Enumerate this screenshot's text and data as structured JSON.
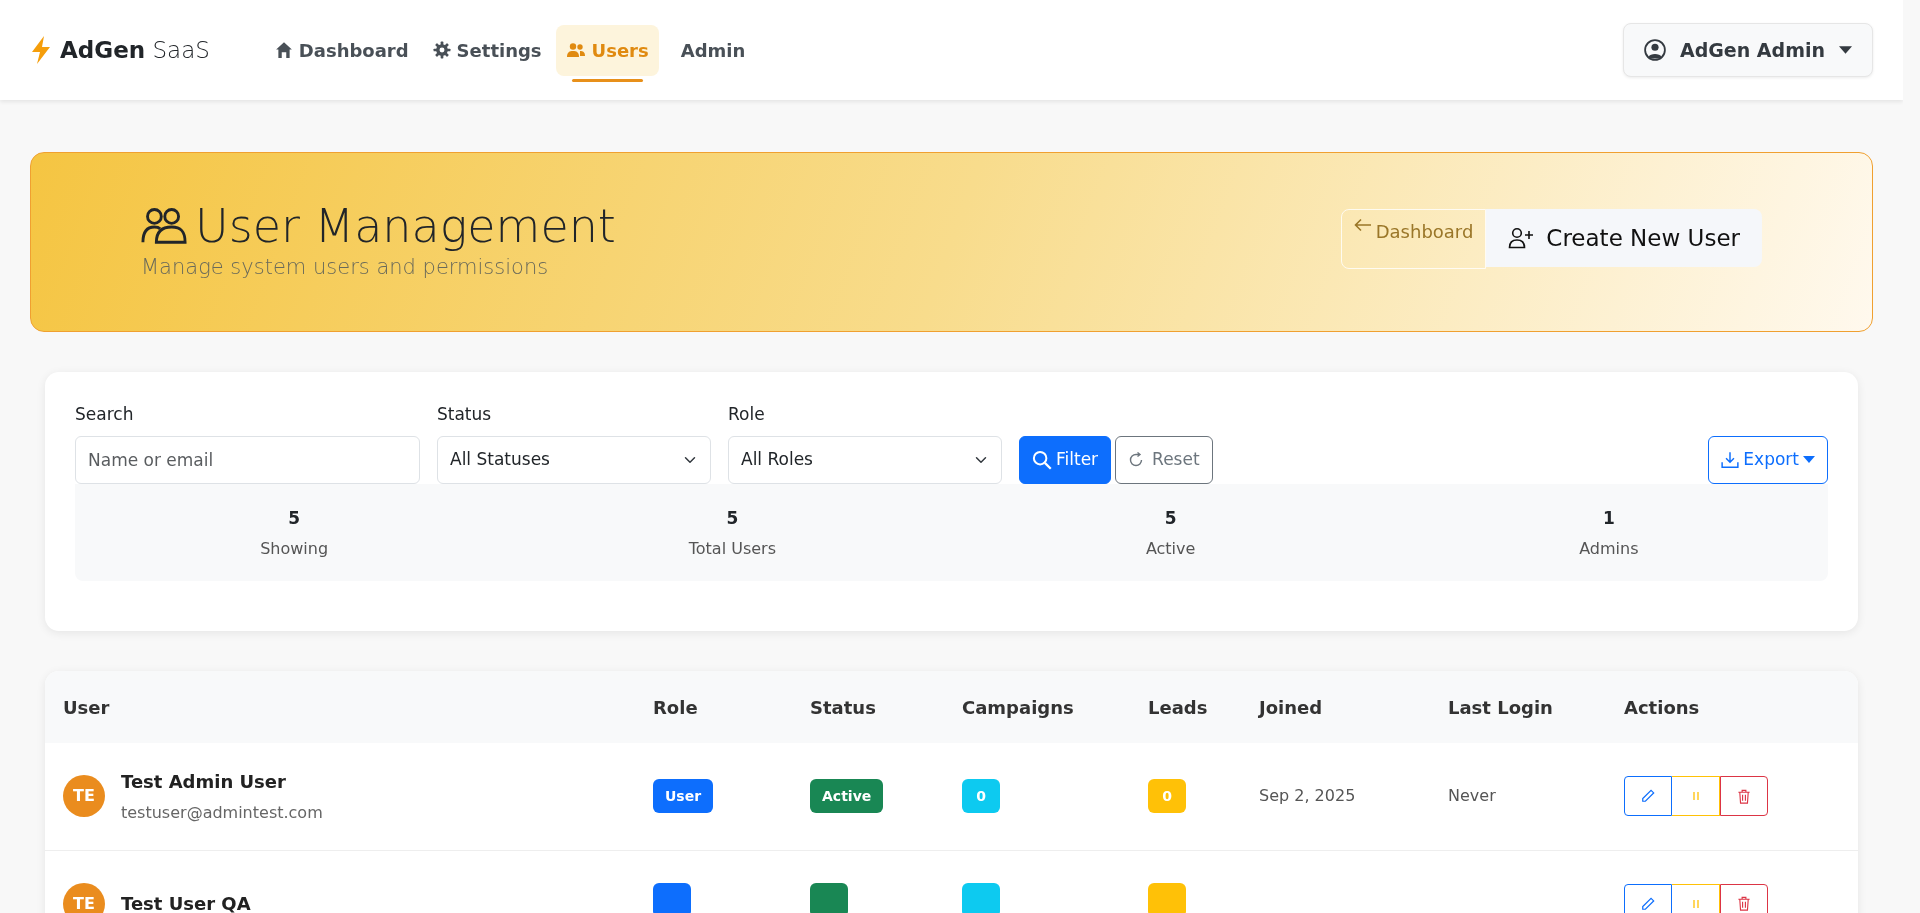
{
  "navbar": {
    "brand": {
      "bold": "AdGen",
      "light": "SaaS"
    },
    "links": [
      {
        "label": "Dashboard",
        "kind": "house",
        "selected": false
      },
      {
        "label": "Settings",
        "kind": "gear",
        "selected": false
      },
      {
        "label": "Users",
        "kind": "users",
        "selected": true
      },
      {
        "label": "Admin",
        "kind": "plain",
        "selected": false
      }
    ],
    "user_menu": "AdGen Admin"
  },
  "header": {
    "title": "User Management",
    "subtitle": "Manage system users and permissions",
    "buttons": [
      {
        "label": "Dashboard",
        "kind": "back"
      },
      {
        "label": "Create New User",
        "kind": "create"
      }
    ]
  },
  "filters": {
    "search": {
      "label": "Search",
      "placeholder": "Name or email"
    },
    "status": {
      "label": "Status",
      "value": "All Statuses"
    },
    "role": {
      "label": "Role",
      "value": "All Roles"
    },
    "buttons": [
      {
        "label": "Filter",
        "kind": "filter"
      },
      {
        "label": "Reset",
        "kind": "reset"
      }
    ],
    "export": "Export"
  },
  "stats": [
    {
      "value": "5",
      "label": "Showing"
    },
    {
      "value": "5",
      "label": "Total Users"
    },
    {
      "value": "5",
      "label": "Active"
    },
    {
      "value": "1",
      "label": "Admins"
    }
  ],
  "table": {
    "columns": [
      "User",
      "Role",
      "Status",
      "Campaigns",
      "Leads",
      "Joined",
      "Last Login",
      "Actions"
    ],
    "rows": [
      {
        "initials": "TE",
        "name": "Test Admin User",
        "email": "testuser@admintest.com",
        "role": {
          "kind": "user",
          "text": "User"
        },
        "status": {
          "kind": "active",
          "text": "Active"
        },
        "campaigns": "0",
        "leads": "0",
        "joined": "Sep 2, 2025",
        "last_login": "Never"
      },
      {
        "initials": "TE",
        "name": "Test User QA",
        "role": {
          "kind": "user"
        },
        "status": {
          "kind": "active"
        }
      }
    ]
  }
}
